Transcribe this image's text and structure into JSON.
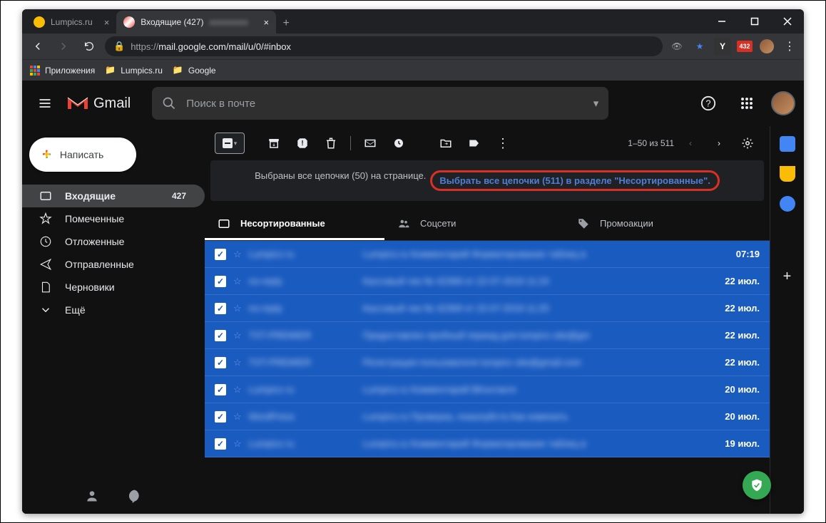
{
  "window": {
    "min": "—",
    "max": "☐",
    "close": "✕"
  },
  "tabs_bar": {
    "t0": {
      "title": "Lumpics.ru",
      "fav": "#fbbc04"
    },
    "t1": {
      "title": "Входящие (427)",
      "fav": "gmail"
    },
    "plus": "+"
  },
  "url": {
    "scheme": "https://",
    "host_path": "mail.google.com/mail/u/0/#inbox"
  },
  "ext_badge": "432",
  "bookmarks": {
    "apps": "Приложения",
    "b1": "Lumpics.ru",
    "b2": "Google"
  },
  "gmail": {
    "brand": "Gmail",
    "search_placeholder": "Поиск в почте",
    "compose": "Написать",
    "sidebar": {
      "inbox": {
        "label": "Входящие",
        "count": "427"
      },
      "starred": {
        "label": "Помеченные"
      },
      "snoozed": {
        "label": "Отложенные"
      },
      "sent": {
        "label": "Отправленные"
      },
      "drafts": {
        "label": "Черновики"
      },
      "more": {
        "label": "Ещё"
      }
    },
    "toolbar": {
      "range": "1–50 из 511"
    },
    "banner": {
      "text": "Выбраны все цепочки (50) на странице.",
      "link": "Выбрать все цепочки (511) в разделе \"Несортированные\"."
    },
    "category_tabs": {
      "primary": "Несортированные",
      "social": "Соцсети",
      "promo": "Промоакции"
    },
    "mail": [
      {
        "sender": "Lumpics ru",
        "subject": "Lumpics.ru Комментарий Форматирование таблиц в",
        "date": "07:19"
      },
      {
        "sender": "no-reply",
        "subject": "Кассовый чек № 42368 от 22-07-2019 11:24",
        "date": "22 июл."
      },
      {
        "sender": "no-reply",
        "subject": "Кассовый чек № 42369 от 22-07-2019 11:25",
        "date": "22 июл."
      },
      {
        "sender": "TXT-PREMIER",
        "subject": "Предоставлен пробный период для lumpics site@gm",
        "date": "22 июл."
      },
      {
        "sender": "TXT-PREMIER",
        "subject": "Регистрация пользователя lumpics site@gmail.com",
        "date": "22 июл."
      },
      {
        "sender": "Lumpics ru",
        "subject": "Lumpics.ru Комментарий ВКонтакте",
        "date": "20 июл."
      },
      {
        "sender": "WordPress",
        "subject": "Lumpics.ru Проверка, пожалуйста Как изменить",
        "date": "20 июл."
      },
      {
        "sender": "Lumpics ru",
        "subject": "Lumpics.ru Комментарий Форматирование таблиц в",
        "date": "19 июл."
      }
    ]
  }
}
